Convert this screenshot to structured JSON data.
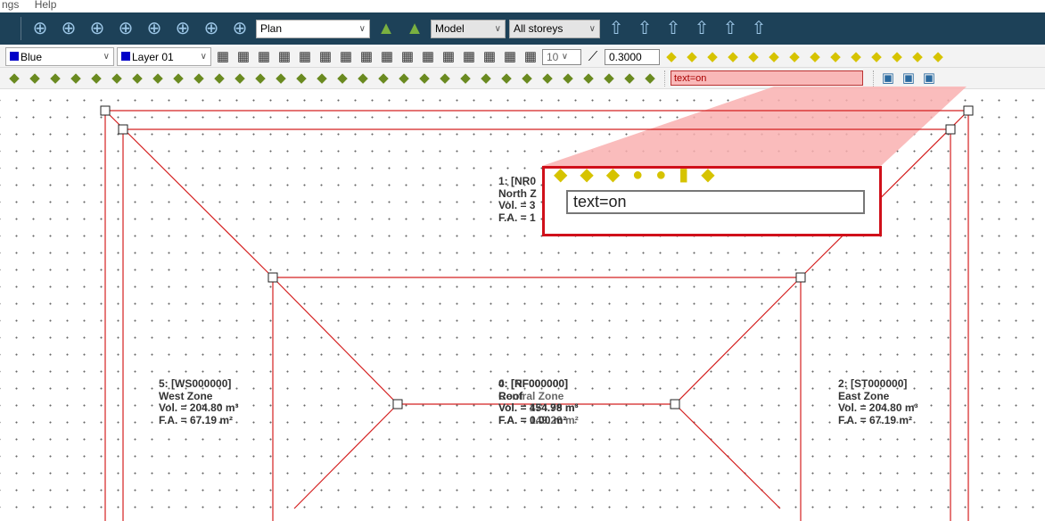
{
  "menu": {
    "items": [
      "ngs",
      "Help"
    ]
  },
  "toolbar_main": {
    "left_icons": [
      "zoom-extents",
      "zoom-object",
      "zoom-window",
      "zoom-in",
      "zoom-out",
      "pan-hand",
      "orbit",
      "orbit-alt"
    ],
    "view_select": "Plan",
    "mid_icons": [
      "person-view",
      "model-toggle"
    ],
    "model_select": "Model",
    "storey_select": "All storeys",
    "right_icons": [
      "storey-up",
      "storey-down",
      "storey-page",
      "north-arrow",
      "refresh",
      "sun-orbit"
    ]
  },
  "toolbar_row2": {
    "color_select": "Blue",
    "layer_select": "Layer 01",
    "snap_icons": [
      "layers",
      "grid-dots",
      "grid-snap",
      "ruler",
      "measure",
      "query-point",
      "guide-line",
      "delete-guide",
      "lock",
      "select-box",
      "ortho",
      "rectangle",
      "perpendicular",
      "angle",
      "parallel",
      "angle-step"
    ],
    "angle_value": "10",
    "offset_value": "0.3000",
    "shape_icons": [
      "offset-left",
      "offset-right",
      "block-draw",
      "wedge",
      "box",
      "cone",
      "sphere",
      "hemisphere",
      "cylinder",
      "shape-extra",
      "roof-tool",
      "xy-coord",
      "tree",
      "solar-panel"
    ],
    "accent": "#d6c300"
  },
  "toolbar_row3": {
    "icons": [
      "add-green",
      "add-cyan",
      "add-brown",
      "location-pin",
      "copy-block",
      "move-block",
      "layer-stack",
      "table-grid",
      "properties",
      "pointer",
      "undo",
      "redo",
      "trash",
      "edit-surface",
      "edit-disabled",
      "edit-red",
      "node-a",
      "node-b",
      "node-c",
      "align",
      "mirror",
      "disabled-a",
      "check-box",
      "disabled-b",
      "disabled-c",
      "gen-a",
      "gen-b",
      "sort",
      "split-a",
      "split-b",
      "paste",
      "brush"
    ],
    "command_text": "text=on",
    "end_icons": [
      "monitor",
      "palette",
      "frame"
    ]
  },
  "magnifier": {
    "command_text": "text=on"
  },
  "zones": [
    {
      "lines": [
        "1: [NR0",
        "North Z",
        "Vol. = 3",
        "F.A. = 1"
      ]
    },
    {
      "lines": [
        "5: [WS000000]",
        "West Zone",
        "Vol. = 204.80 m³",
        "F.A. = 67.19 m²"
      ]
    },
    {
      "lines": [
        "0: [RF000000]",
        "Roof",
        "Vol. = 454.98 m³",
        "F.A. = 0.00 m²"
      ]
    },
    {
      "lines": [
        "4: [NF000000]",
        "Central Zone",
        "Vol. = 174.79 m³",
        "F.A. = 149.26 m²"
      ]
    },
    {
      "lines": [
        "2: [ST000000]",
        "East Zone",
        "Vol. = 204.80 m³",
        "F.A. = 67.19 m²"
      ]
    }
  ],
  "colors": {
    "geometry": "#d42020",
    "toolbar_dark": "#1d4158",
    "highlight": "#f9b8b8"
  }
}
